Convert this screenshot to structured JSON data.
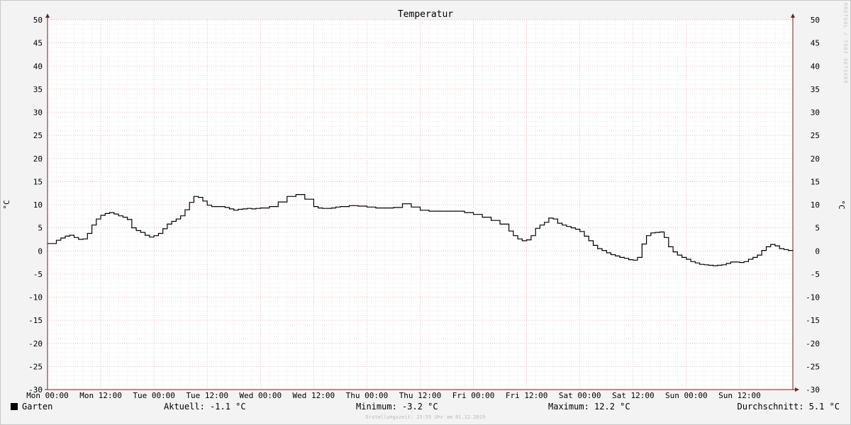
{
  "watermark": "RRDTOOL / TOBI OETIKER",
  "footer": "Erstellungszeit: 23:55 Uhr am 01.12.2019",
  "legend": {
    "series_name": "Garten",
    "aktuell": "Aktuell: -1.1 °C",
    "minimum": "Minimum: -3.2 °C",
    "maximum": "Maximum: 12.2 °C",
    "durchschnitt": "Durchschnitt: 5.1 °C"
  },
  "colors": {
    "background": "#f3f3f3",
    "canvas": "#ffffff",
    "major_grid": "#e8a0a0",
    "minor_grid": "#d8d8d8",
    "axis": "#7a1d1d",
    "line": "#000000"
  },
  "chart_data": {
    "type": "line",
    "title": "Temperatur",
    "ylabel": "°C",
    "ylabel_right": "°C",
    "xlabel": "",
    "ylim": [
      -30,
      50
    ],
    "yticks": [
      -30,
      -25,
      -20,
      -15,
      -10,
      -5,
      0,
      5,
      10,
      15,
      20,
      25,
      30,
      35,
      40,
      45,
      50
    ],
    "xlim_hours": [
      0,
      168
    ],
    "xticks": [
      "Mon 00:00",
      "Mon 12:00",
      "Tue 00:00",
      "Tue 12:00",
      "Wed 00:00",
      "Wed 12:00",
      "Thu 00:00",
      "Thu 12:00",
      "Fri 00:00",
      "Fri 12:00",
      "Sat 00:00",
      "Sat 12:00",
      "Sun 00:00",
      "Sun 12:00"
    ],
    "grid": true,
    "step": true,
    "series": [
      {
        "name": "Garten",
        "color": "#000000",
        "x_hours": [
          0,
          2,
          3,
          4,
          5,
          6,
          7,
          8,
          9,
          10,
          11,
          12,
          13,
          14,
          15,
          16,
          17,
          18,
          19,
          20,
          21,
          22,
          23,
          24,
          25,
          26,
          27,
          28,
          29,
          30,
          31,
          32,
          33,
          34,
          35,
          36,
          37,
          38,
          39,
          40,
          41,
          42,
          43,
          44,
          45,
          46,
          47,
          48,
          50,
          52,
          54,
          56,
          58,
          60,
          61,
          62,
          63,
          64,
          65,
          66,
          67,
          68,
          70,
          72,
          74,
          76,
          78,
          80,
          82,
          84,
          86,
          88,
          90,
          92,
          94,
          96,
          98,
          100,
          102,
          104,
          105,
          106,
          107,
          108,
          109,
          110,
          111,
          112,
          113,
          114,
          115,
          116,
          117,
          118,
          119,
          120,
          121,
          122,
          123,
          124,
          125,
          126,
          127,
          128,
          129,
          130,
          131,
          132,
          133,
          134,
          135,
          136,
          137,
          138,
          139,
          140,
          141,
          142,
          143,
          144,
          145,
          146,
          147,
          148,
          149,
          150,
          151,
          152,
          153,
          154,
          155,
          156,
          157,
          158,
          159,
          160,
          161,
          162,
          163,
          164,
          165,
          166,
          167
        ],
        "values": [
          1.6,
          2.3,
          2.8,
          3.2,
          3.4,
          2.9,
          2.5,
          2.6,
          3.8,
          5.6,
          6.9,
          7.7,
          8.1,
          8.3,
          8.0,
          7.6,
          7.3,
          6.8,
          5.0,
          4.4,
          4.0,
          3.4,
          3.0,
          3.3,
          3.8,
          4.8,
          5.8,
          6.4,
          6.9,
          7.6,
          8.9,
          10.5,
          11.8,
          11.6,
          10.8,
          9.9,
          9.6,
          9.6,
          9.6,
          9.4,
          9.1,
          8.8,
          9.0,
          9.1,
          9.2,
          9.1,
          9.2,
          9.3,
          9.6,
          10.6,
          11.8,
          12.2,
          11.2,
          9.6,
          9.3,
          9.2,
          9.2,
          9.3,
          9.5,
          9.6,
          9.6,
          9.8,
          9.7,
          9.5,
          9.3,
          9.3,
          9.4,
          10.2,
          9.5,
          8.8,
          8.6,
          8.6,
          8.6,
          8.6,
          8.3,
          7.9,
          7.3,
          6.6,
          5.8,
          4.3,
          3.3,
          2.6,
          2.2,
          2.4,
          3.3,
          4.9,
          5.6,
          6.2,
          7.1,
          6.9,
          6.0,
          5.6,
          5.3,
          5.0,
          4.7,
          4.2,
          3.2,
          2.2,
          1.2,
          0.5,
          0.1,
          -0.4,
          -0.8,
          -1.1,
          -1.4,
          -1.6,
          -1.9,
          -2.0,
          -1.4,
          1.5,
          3.3,
          3.9,
          4.0,
          4.1,
          2.9,
          0.9,
          -0.2,
          -0.9,
          -1.4,
          -1.8,
          -2.3,
          -2.6,
          -2.9,
          -3.0,
          -3.1,
          -3.2,
          -3.1,
          -3.0,
          -2.7,
          -2.4,
          -2.4,
          -2.5,
          -2.3,
          -1.8,
          -1.4,
          -0.9,
          0.1,
          0.9,
          1.4,
          1.1,
          0.5,
          0.3,
          0.1,
          -0.1,
          -0.3,
          -0.9,
          -1.1
        ]
      }
    ]
  }
}
